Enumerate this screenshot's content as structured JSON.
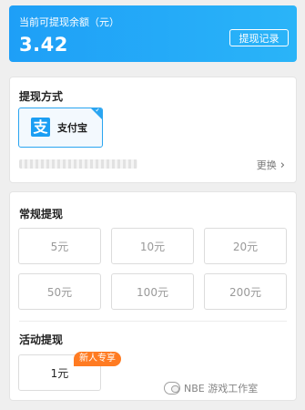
{
  "balance": {
    "label": "当前可提现余额（元）",
    "amount": "3.42",
    "record_button": "提现记录"
  },
  "method": {
    "title": "提现方式",
    "option": {
      "icon": "alipay-icon",
      "icon_glyph": "支",
      "name": "支付宝",
      "selected": true
    },
    "change_label": "更换"
  },
  "regular": {
    "title": "常规提现",
    "amounts": [
      "5元",
      "10元",
      "20元",
      "50元",
      "100元",
      "200元"
    ]
  },
  "activity": {
    "title": "活动提现",
    "amount": "1元",
    "badge": "新人专享"
  },
  "watermark": {
    "text": "NBE 游戏工作室"
  },
  "colors": {
    "accent": "#1e9ff7",
    "badge": "#ff7b22"
  }
}
